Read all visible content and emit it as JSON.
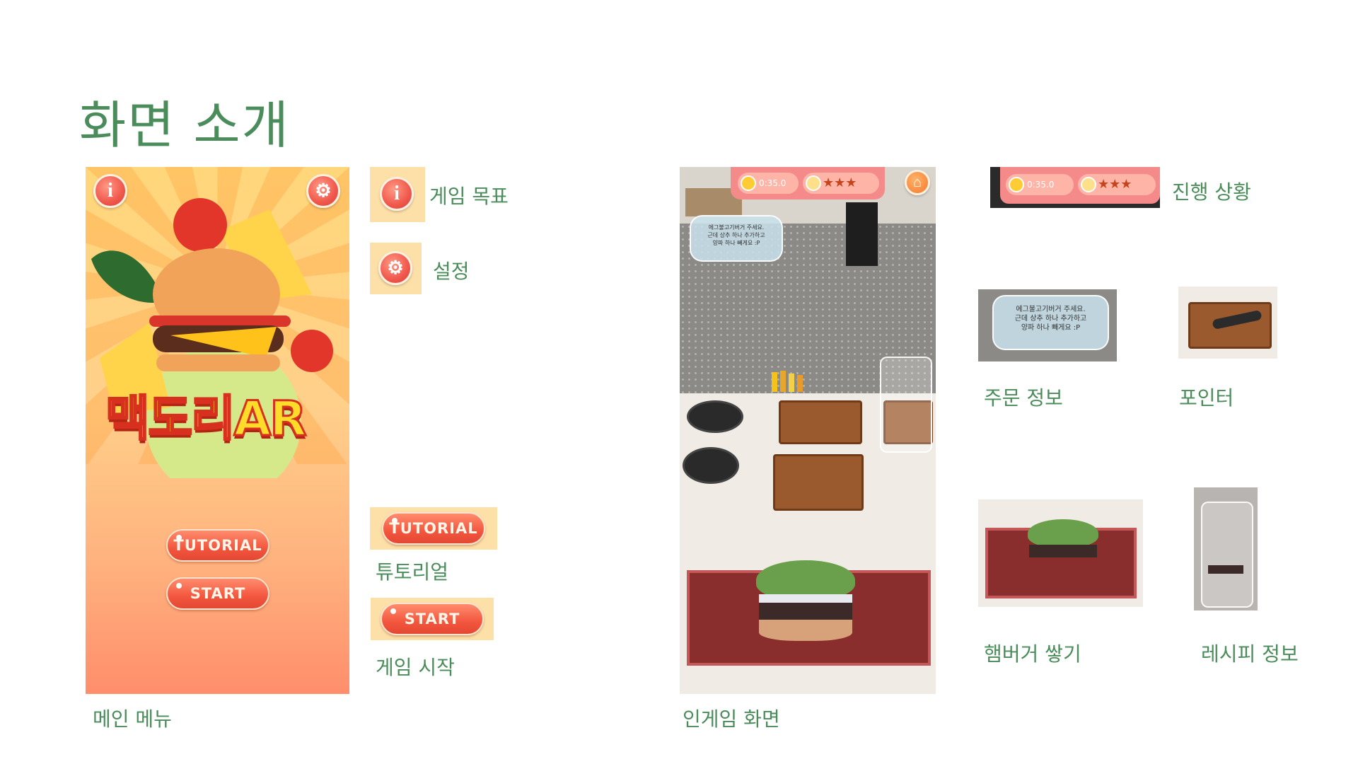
{
  "slide": {
    "title": "화면 소개"
  },
  "main_menu": {
    "caption": "메인 메뉴",
    "info_button_glyph": "i",
    "settings_icon": "gear-icon",
    "logo_text": "맥도리AR",
    "tutorial_label": "TUTORIAL",
    "start_label": "START"
  },
  "menu_callouts": {
    "goal": {
      "label": "게임 목표",
      "glyph": "i"
    },
    "settings": {
      "label": "설정",
      "icon": "gear-icon"
    },
    "tutorial": {
      "label": "튜토리얼",
      "button": "TUTORIAL"
    },
    "start": {
      "label": "게임 시작",
      "button": "START"
    }
  },
  "in_game": {
    "caption": "인게임 화면",
    "timer": "0:35.0",
    "stars": "★★★",
    "home_icon": "home-icon",
    "order_line1": "에그불고기버거 주세요.",
    "order_line2": "근데 상추 하나 추가하고",
    "order_line3": "양파 하나 빼게요 :P"
  },
  "game_callouts": {
    "progress": {
      "label": "진행 상황",
      "timer": "0:35.0",
      "stars": "★★★"
    },
    "order": {
      "label": "주문 정보"
    },
    "pointer": {
      "label": "포인터"
    },
    "stacking": {
      "label": "햄버거 쌓기"
    },
    "recipe": {
      "label": "레시피 정보"
    }
  },
  "colors": {
    "accent_green": "#4a8c5a",
    "button_red": "#f3563e",
    "hud_pink": "#f58a8a"
  }
}
